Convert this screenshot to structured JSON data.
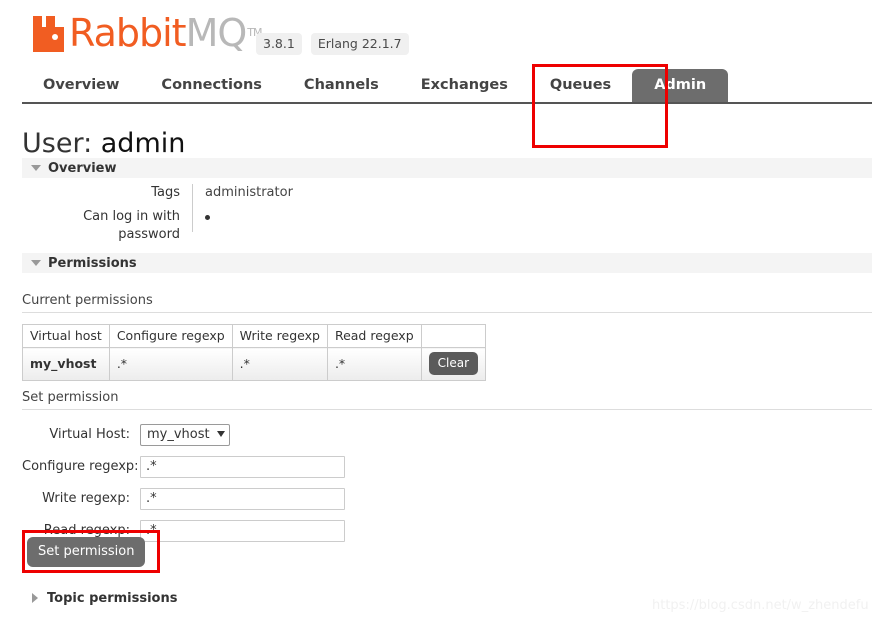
{
  "header": {
    "logo_rabbit": "Rabbit",
    "logo_mq": "MQ",
    "logo_tm": "TM",
    "badges": [
      "3.8.1",
      "Erlang 22.1.7"
    ]
  },
  "nav": {
    "tabs": [
      {
        "label": "Overview",
        "active": false
      },
      {
        "label": "Connections",
        "active": false
      },
      {
        "label": "Channels",
        "active": false
      },
      {
        "label": "Exchanges",
        "active": false
      },
      {
        "label": "Queues",
        "active": false
      },
      {
        "label": "Admin",
        "active": true
      }
    ]
  },
  "page": {
    "title_prefix": "User:",
    "title_name": "admin"
  },
  "overview": {
    "section_label": "Overview",
    "rows": [
      {
        "key": "Tags",
        "value": "administrator"
      },
      {
        "key": "Can log in with password",
        "value": ""
      }
    ]
  },
  "permissions": {
    "section_label": "Permissions",
    "current_subtitle": "Current permissions",
    "table": {
      "columns": [
        "Virtual host",
        "Configure regexp",
        "Write regexp",
        "Read regexp",
        ""
      ],
      "rows": [
        {
          "vhost": "my_vhost",
          "configure": ".*",
          "write": ".*",
          "read": ".*",
          "action": "Clear"
        }
      ]
    },
    "set_subtitle": "Set permission",
    "form": {
      "vhost_label": "Virtual Host:",
      "vhost_value": "my_vhost",
      "vhost_options": [
        "my_vhost"
      ],
      "configure_label": "Configure regexp:",
      "configure_value": ".*",
      "write_label": "Write regexp:",
      "write_value": ".*",
      "read_label": "Read regexp:",
      "read_value": ".*",
      "submit_label": "Set permission"
    }
  },
  "topic_permissions": {
    "section_label": "Topic permissions"
  },
  "watermark": {
    "text": "https://blog.csdn.net/w_zhendefu"
  },
  "colors": {
    "brand_orange": "#f15d22",
    "tab_active_bg": "#6d6d6d",
    "annotation_red": "#ee0000"
  }
}
